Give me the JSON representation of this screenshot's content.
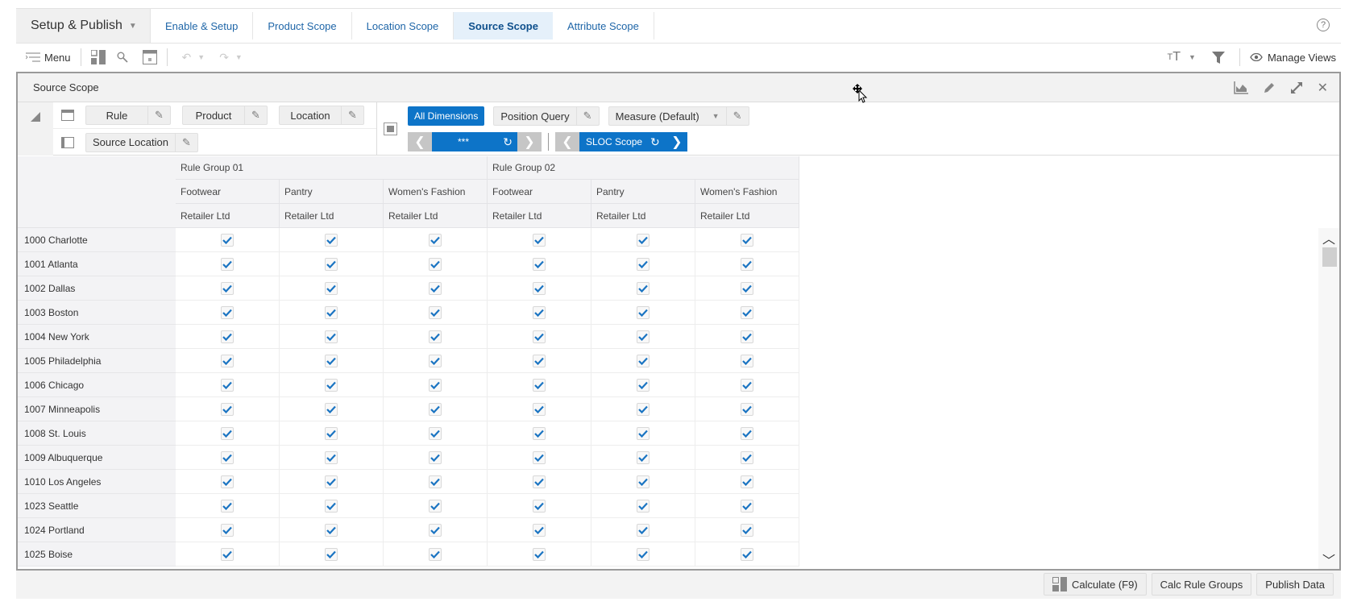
{
  "app_switcher": {
    "label": "Setup & Publish"
  },
  "tabs": [
    {
      "label": "Enable & Setup",
      "active": false
    },
    {
      "label": "Product Scope",
      "active": false
    },
    {
      "label": "Location Scope",
      "active": false
    },
    {
      "label": "Source Scope",
      "active": true
    },
    {
      "label": "Attribute Scope",
      "active": false
    }
  ],
  "toolbar": {
    "menu_label": "Menu",
    "manage_views_label": "Manage Views"
  },
  "panel": {
    "title": "Source Scope",
    "pivot": {
      "row_tiles": [
        "Rule",
        "Product",
        "Location"
      ],
      "column_tiles": [
        "Source Location"
      ],
      "all_dimensions_label": "All Dimensions",
      "position_query_label": "Position Query",
      "measure_label": "Measure (Default)",
      "nav1_label": "***",
      "nav2_label": "SLOC Scope"
    },
    "grid": {
      "column_groups": [
        {
          "label": "Rule Group 01",
          "span": 3
        },
        {
          "label": "Rule Group 02",
          "span": 3
        }
      ],
      "columns": [
        {
          "product": "Footwear",
          "location": "Retailer Ltd"
        },
        {
          "product": "Pantry",
          "location": "Retailer Ltd"
        },
        {
          "product": "Women's Fashion",
          "location": "Retailer Ltd"
        },
        {
          "product": "Footwear",
          "location": "Retailer Ltd"
        },
        {
          "product": "Pantry",
          "location": "Retailer Ltd"
        },
        {
          "product": "Women's Fashion",
          "location": "Retailer Ltd"
        }
      ],
      "rows": [
        {
          "label": "1000 Charlotte",
          "values": [
            true,
            true,
            true,
            true,
            true,
            true
          ]
        },
        {
          "label": "1001 Atlanta",
          "values": [
            true,
            true,
            true,
            true,
            true,
            true
          ]
        },
        {
          "label": "1002 Dallas",
          "values": [
            true,
            true,
            true,
            true,
            true,
            true
          ]
        },
        {
          "label": "1003 Boston",
          "values": [
            true,
            true,
            true,
            true,
            true,
            true
          ]
        },
        {
          "label": "1004 New York",
          "values": [
            true,
            true,
            true,
            true,
            true,
            true
          ]
        },
        {
          "label": "1005 Philadelphia",
          "values": [
            true,
            true,
            true,
            true,
            true,
            true
          ]
        },
        {
          "label": "1006 Chicago",
          "values": [
            true,
            true,
            true,
            true,
            true,
            true
          ]
        },
        {
          "label": "1007 Minneapolis",
          "values": [
            true,
            true,
            true,
            true,
            true,
            true
          ]
        },
        {
          "label": "1008 St. Louis",
          "values": [
            true,
            true,
            true,
            true,
            true,
            true
          ]
        },
        {
          "label": "1009 Albuquerque",
          "values": [
            true,
            true,
            true,
            true,
            true,
            true
          ]
        },
        {
          "label": "1010 Los Angeles",
          "values": [
            true,
            true,
            true,
            true,
            true,
            true
          ]
        },
        {
          "label": "1023 Seattle",
          "values": [
            true,
            true,
            true,
            true,
            true,
            true
          ]
        },
        {
          "label": "1024 Portland",
          "values": [
            true,
            true,
            true,
            true,
            true,
            true
          ]
        },
        {
          "label": "1025 Boise",
          "values": [
            true,
            true,
            true,
            true,
            true,
            true
          ]
        }
      ]
    }
  },
  "footer": {
    "calculate_label": "Calculate (F9)",
    "calc_rule_groups_label": "Calc Rule Groups",
    "publish_data_label": "Publish Data"
  },
  "colors": {
    "accent": "#0d74c8",
    "active_tab_bg": "#e5f0fa",
    "tab_text": "#1f66a8"
  }
}
